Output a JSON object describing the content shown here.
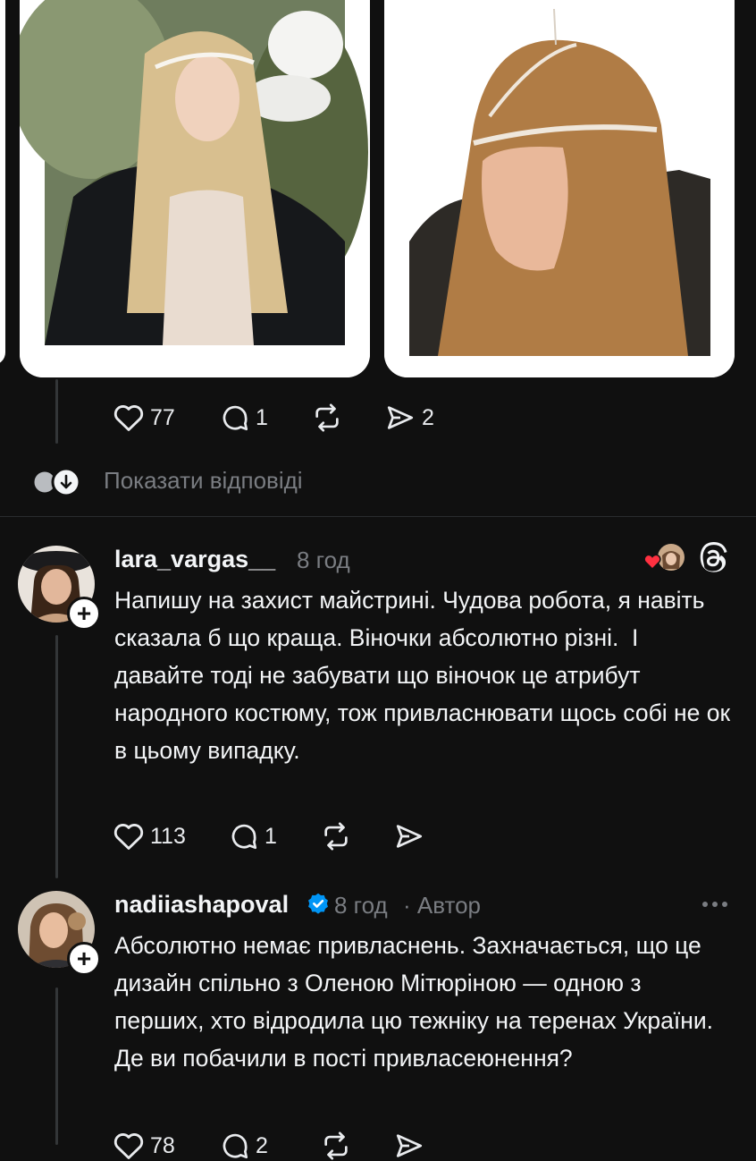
{
  "post": {
    "likes": "77",
    "replies": "1",
    "shares": "2",
    "show_replies": "Показати відповіді"
  },
  "comments": [
    {
      "username": "lara_vargas__",
      "time": "8 год",
      "text": "Напишу на захист майстрині. Чудова робота, я навіть сказала б що краща. Віночки абсолютно різні.  І давайте тоді не забувати що віночок це атрибут народного костюму, тож привласнювати щось собі не ок в цьому випадку.",
      "likes": "113",
      "replies": "1"
    },
    {
      "username": "nadiiashapoval",
      "time": "8 год",
      "author_label": "· Автор",
      "text": "Абсолютно немає привласнень. Захначається, що це дизайн спільно з Оленою Мітюріною — одною з перших, хто відродила цю тежніку на теренах України. Де ви побачили в пості привласеюнення?",
      "likes": "78",
      "replies": "2"
    }
  ],
  "colors": {
    "background": "#101010",
    "text": "#f3f5f7",
    "muted": "#7a7d82",
    "verified": "#0095f6",
    "heart_red": "#ff3040"
  },
  "icons": [
    "heart-icon",
    "comment-icon",
    "repost-icon",
    "share-icon",
    "threads-icon",
    "more-icon",
    "verified-icon",
    "plus-icon"
  ]
}
